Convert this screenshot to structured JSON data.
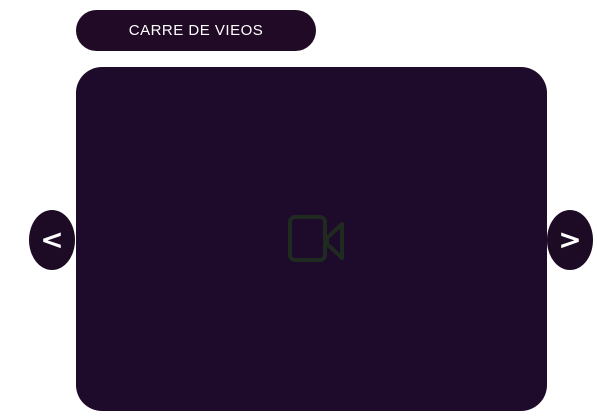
{
  "header": {
    "title": "CARRE DE VIEOS"
  },
  "carousel": {
    "prev_label": "<",
    "next_label": ">",
    "placeholder_icon": "video-camera-icon"
  },
  "colors": {
    "panel_background": "#1e0a2a",
    "title_background": "#210a26",
    "nav_background": "#1d0a24",
    "icon_color": "#1e2a1e",
    "text_color": "#ffffff"
  }
}
